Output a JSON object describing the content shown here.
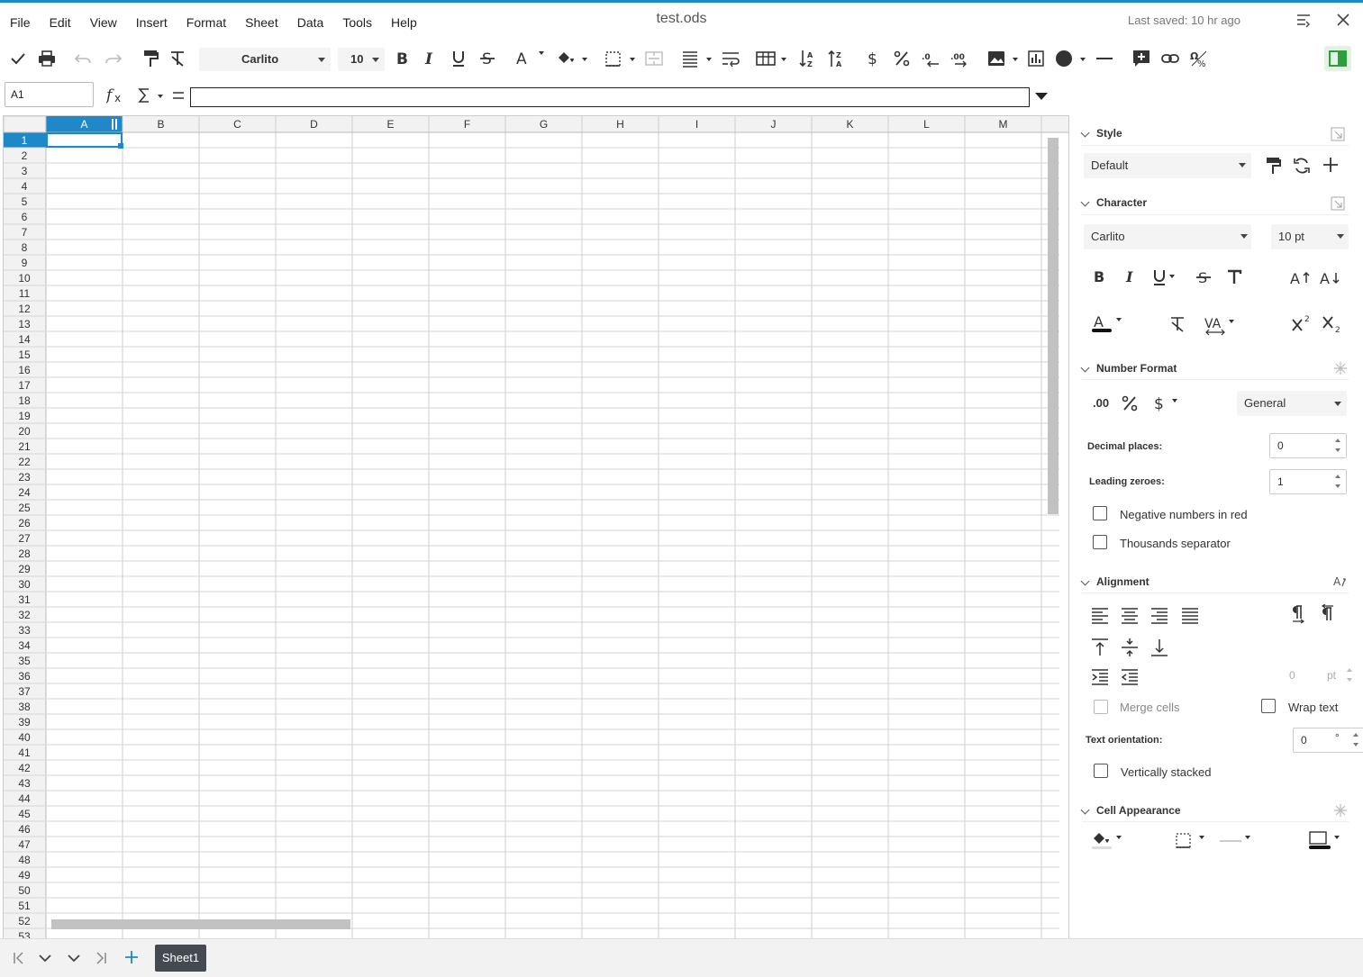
{
  "menu": {
    "items": [
      "File",
      "Edit",
      "View",
      "Insert",
      "Format",
      "Sheet",
      "Data",
      "Tools",
      "Help"
    ]
  },
  "document": {
    "title": "test.ods",
    "last_saved": "Last saved: 10 hr ago"
  },
  "toolbar": {
    "font_name": "Carlito",
    "font_size": "10"
  },
  "formula_bar": {
    "cell_reference": "A1",
    "formula_value": ""
  },
  "grid": {
    "columns": [
      "A",
      "B",
      "C",
      "D",
      "E",
      "F",
      "G",
      "H",
      "I",
      "J",
      "K",
      "L",
      "M"
    ],
    "rows": [
      "1",
      "2",
      "3",
      "4",
      "5",
      "6",
      "7",
      "8",
      "9",
      "10",
      "11",
      "12",
      "13",
      "14",
      "15",
      "16",
      "17",
      "18",
      "19",
      "20",
      "21",
      "22",
      "23",
      "24",
      "25",
      "26",
      "27",
      "28",
      "29",
      "30",
      "31",
      "32",
      "33",
      "34",
      "35",
      "36",
      "37",
      "38",
      "39",
      "40",
      "41",
      "42",
      "43",
      "44",
      "45",
      "46",
      "47",
      "48",
      "49",
      "50",
      "51",
      "52",
      "53"
    ],
    "selected_cell": "A1"
  },
  "sidebar": {
    "style": {
      "title": "Style",
      "value": "Default"
    },
    "character": {
      "title": "Character",
      "font": "Carlito",
      "size": "10 pt"
    },
    "number_format": {
      "title": "Number Format",
      "decimal_button": ".00",
      "format": "General",
      "decimal_places_label": "Decimal places:",
      "decimal_places_value": "0",
      "leading_zeroes_label": "Leading zeroes:",
      "leading_zeroes_value": "1",
      "negative_red_label": "Negative numbers in red",
      "thousands_label": "Thousands separator"
    },
    "alignment": {
      "title": "Alignment",
      "indent_value": "0",
      "indent_unit": "pt",
      "merge_label": "Merge cells",
      "wrap_label": "Wrap text",
      "orientation_label": "Text orientation:",
      "orientation_value": "0",
      "orientation_unit": "°",
      "stacked_label": "Vertically stacked"
    },
    "cell_appearance": {
      "title": "Cell Appearance"
    }
  },
  "sheets": {
    "tabs": [
      "Sheet1"
    ]
  },
  "colors": {
    "accent": "#1e88c8",
    "selected_header": "#1e88c8",
    "sidebar_toggle": "#2e9e3e"
  }
}
